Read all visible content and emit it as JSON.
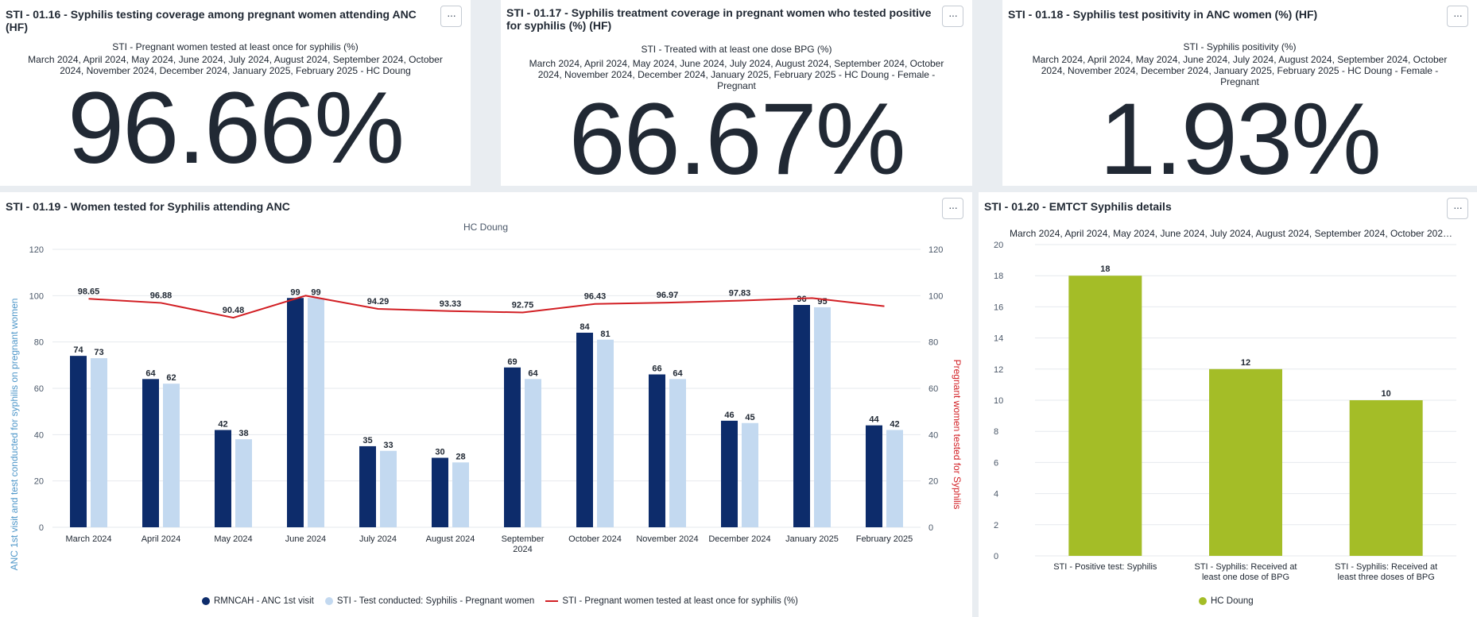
{
  "kpis": [
    {
      "title": "STI - 01.16 - Syphilis testing coverage among pregnant women attending ANC (HF)",
      "subtitle": "STI - Pregnant women tested at least once for syphilis (%)",
      "period": "March 2024, April 2024, May 2024, June 2024, July 2024, August 2024, September 2024, October 2024, November 2024, December 2024, January 2025, February 2025 - HC Doung",
      "value": "96.66%"
    },
    {
      "title": "STI - 01.17 - Syphilis treatment coverage in pregnant women who tested positive for syphilis (%) (HF)",
      "subtitle": "STI - Treated with at least one dose BPG (%)",
      "period": "March 2024, April 2024, May 2024, June 2024, July 2024, August 2024, September 2024, October 2024, November 2024, December 2024, January 2025, February 2025 - HC Doung - Female - Pregnant",
      "value": "66.67%"
    },
    {
      "title": "STI - 01.18 - Syphilis test positivity in ANC women (%) (HF)",
      "subtitle": "STI - Syphilis positivity (%)",
      "period": "March 2024, April 2024, May 2024, June 2024, July 2024, August 2024, September 2024, October 2024, November 2024, December 2024, January 2025, February 2025 - HC Doung - Female - Pregnant",
      "value": "1.93%"
    }
  ],
  "menu_label": "···",
  "charts": {
    "anc": {
      "title": "STI - 01.19 - Women tested for Syphilis attending ANC",
      "chart_subtitle": "HC Doung",
      "y_left_label": "ANC 1st visit and test conducted for syphilis on pregnant women",
      "y_right_label": "Pregnant women tested for Syphilis",
      "legend": [
        "RMNCAH - ANC 1st visit",
        "STI - Test conducted: Syphilis - Pregnant women",
        "STI - Pregnant women tested at least once for syphilis (%)"
      ]
    },
    "emtct": {
      "title": "STI - 01.20 - EMTCT Syphilis details",
      "period": "March 2024, April 2024, May 2024, June 2024, July 2024, August 2024, September 2024, October 202…",
      "legend": [
        "HC Doung"
      ]
    }
  },
  "chart_data": [
    {
      "type": "bar",
      "title": "STI - 01.19 - Women tested for Syphilis attending ANC",
      "subtitle": "HC Doung",
      "categories": [
        "March 2024",
        "April 2024",
        "May 2024",
        "June 2024",
        "July 2024",
        "August 2024",
        "September 2024",
        "October 2024",
        "November 2024",
        "December 2024",
        "January 2025",
        "February 2025"
      ],
      "series": [
        {
          "name": "RMNCAH - ANC 1st visit",
          "type": "bar",
          "axis": "left",
          "color": "#0d2c6b",
          "values": [
            74,
            64,
            42,
            99,
            35,
            30,
            69,
            84,
            66,
            46,
            96,
            44
          ]
        },
        {
          "name": "STI - Test conducted: Syphilis - Pregnant women",
          "type": "bar",
          "axis": "left",
          "color": "#c3d9f0",
          "values": [
            73,
            62,
            38,
            99,
            33,
            28,
            64,
            81,
            64,
            45,
            95,
            42
          ]
        },
        {
          "name": "STI - Pregnant women tested at least once for syphilis (%)",
          "type": "line",
          "axis": "right",
          "color": "#d21f24",
          "values": [
            98.65,
            96.88,
            90.48,
            100,
            94.29,
            93.33,
            92.75,
            96.43,
            96.97,
            97.83,
            98.96,
            95.45
          ],
          "labels": [
            "98.65",
            "96.88",
            "90.48",
            "",
            "94.29",
            "93.33",
            "92.75",
            "96.43",
            "96.97",
            "97.83",
            "",
            ""
          ]
        }
      ],
      "ylabel": "ANC 1st visit and test conducted for syphilis on pregnant women",
      "y2label": "Pregnant women tested for Syphilis",
      "ylim": [
        0,
        120
      ],
      "y2lim": [
        0,
        120
      ],
      "yticks": [
        0,
        20,
        40,
        60,
        80,
        100,
        120
      ],
      "grid": true,
      "legend_position": "bottom"
    },
    {
      "type": "bar",
      "title": "STI - 01.20 - EMTCT Syphilis details",
      "categories": [
        "STI - Positive test: Syphilis",
        "STI - Syphilis: Received at least one dose of BPG",
        "STI - Syphilis: Received at least three doses of BPG"
      ],
      "series": [
        {
          "name": "HC Doung",
          "color": "#a4bd27",
          "values": [
            18,
            12,
            10
          ]
        }
      ],
      "ylim": [
        0,
        20
      ],
      "yticks": [
        0,
        2,
        4,
        6,
        8,
        10,
        12,
        14,
        16,
        18,
        20
      ],
      "grid": true,
      "legend_position": "bottom"
    }
  ]
}
